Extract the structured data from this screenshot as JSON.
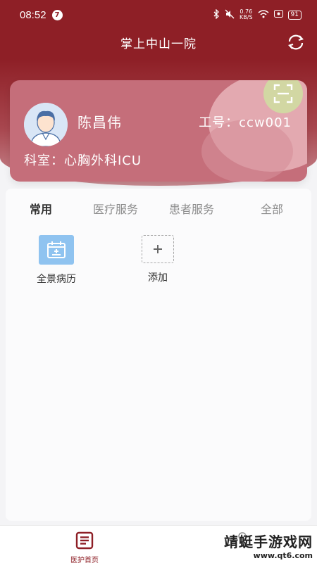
{
  "status_bar": {
    "time": "08:52",
    "notification_count": "7",
    "net_speed_value": "0.76",
    "net_speed_unit": "KB/S",
    "battery": "91"
  },
  "header": {
    "title": "掌上中山一院"
  },
  "profile": {
    "name": "陈昌伟",
    "employee_id": "工号：ccw001",
    "department": "科室：心胸外科ICU"
  },
  "tabs": [
    "常用",
    "医疗服务",
    "患者服务",
    "全部"
  ],
  "grid_items": [
    {
      "label": "全景病历",
      "icon": "calendar-record-icon"
    },
    {
      "label": "添加",
      "icon": "add-icon"
    }
  ],
  "bottom_nav": {
    "home_label": "医护首页"
  },
  "watermark": {
    "text": "靖蜓手游戏网",
    "url": "www.qt6.com"
  },
  "colors": {
    "brand": "#8e1f26",
    "card": "#c56e7a",
    "icon_blue": "#8fc3f0"
  }
}
